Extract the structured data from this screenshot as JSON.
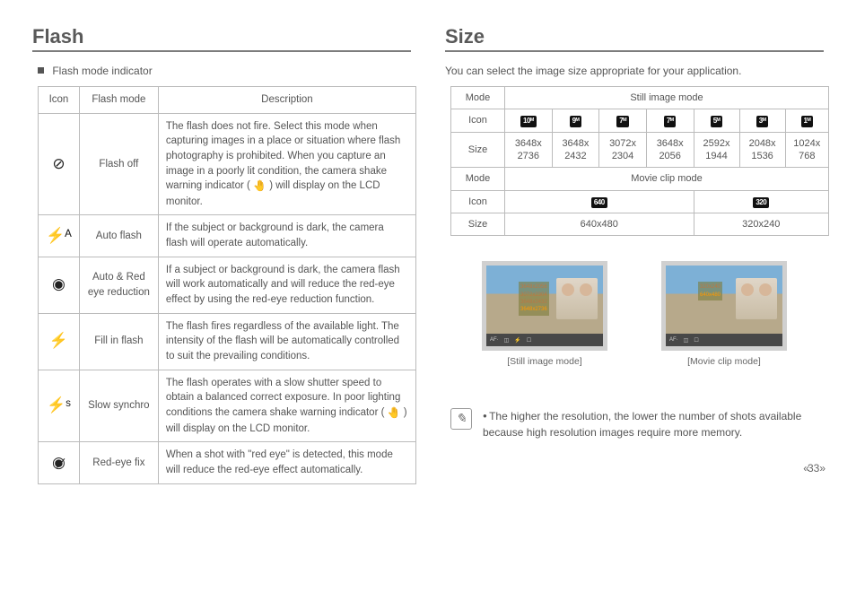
{
  "flash": {
    "heading": "Flash",
    "intro": "Flash mode indicator",
    "headers": {
      "icon": "Icon",
      "mode": "Flash mode",
      "desc": "Description"
    },
    "rows": [
      {
        "icon": "⊘",
        "mode": "Flash off",
        "desc_pre": "The flash does not fire. Select this mode when capturing images in a place or situation where flash photography is prohibited. When you capture an image in a poorly lit condition, the camera shake warning indicator (",
        "desc_icon": "🤚",
        "desc_post": ") will display on the LCD monitor."
      },
      {
        "icon": "⚡ᴬ",
        "mode": "Auto flash",
        "desc": "If the subject or background is dark, the camera flash will operate automatically."
      },
      {
        "icon": "◉",
        "mode": "Auto & Red eye reduction",
        "desc": "If a subject or background is dark, the camera flash will work automatically and will reduce the red-eye effect by using the red-eye reduction function."
      },
      {
        "icon": "⚡",
        "mode": "Fill in flash",
        "desc": "The flash fires regardless of the available light. The intensity of the flash will be automatically controlled to suit the prevailing conditions."
      },
      {
        "icon": "⚡ˢ",
        "mode": "Slow synchro",
        "desc_pre": "The flash operates with a slow shutter speed to obtain a balanced correct exposure. In poor lighting conditions the camera shake warning indicator (",
        "desc_icon": "🤚",
        "desc_post": ") will display on the LCD monitor."
      },
      {
        "icon": "◉̷",
        "mode": "Red-eye fix",
        "desc": "When a shot with \"red eye\" is detected, this mode will reduce the red-eye effect automatically."
      }
    ]
  },
  "size": {
    "heading": "Size",
    "intro": "You can select the image size appropriate for your application.",
    "labels": {
      "mode": "Mode",
      "icon": "Icon",
      "size": "Size"
    },
    "still": {
      "title": "Still image mode",
      "icons": [
        "10ᴹ",
        "9ᴹ",
        "7ᴹ",
        "7ᴹ",
        "5ᴹ",
        "3ᴹ",
        "1ᴹ"
      ],
      "sizes": [
        "3648x 2736",
        "3648x 2432",
        "3072x 2304",
        "3648x 2056",
        "2592x 1944",
        "2048x 1536",
        "1024x 768"
      ]
    },
    "movie": {
      "title": "Movie clip mode",
      "icons": [
        "640",
        "320"
      ],
      "sizes": [
        "640x480",
        "320x240"
      ]
    },
    "preview_still": {
      "caption": "[Still image mode]",
      "menu": [
        "3648x2056",
        "3072x2304",
        "3648x2432",
        "3648x2736"
      ]
    },
    "preview_movie": {
      "caption": "[Movie clip mode]",
      "menu": [
        "320x240",
        "640x480"
      ]
    },
    "note": "The higher the resolution, the lower the number of shots available because high resolution images require more memory."
  },
  "page_number": "33"
}
